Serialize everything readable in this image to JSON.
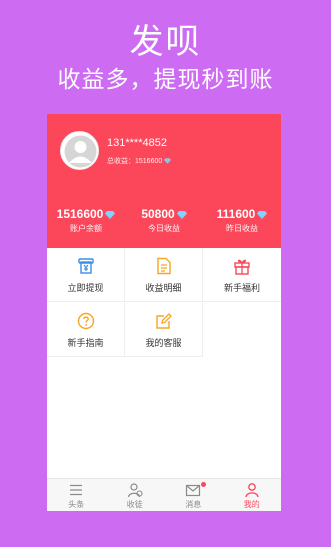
{
  "promo": {
    "title": "发呗",
    "subtitle": "收益多，提现秒到账"
  },
  "profile": {
    "phone": "131****4852",
    "total_label": "总收益：",
    "total_value": "1516600"
  },
  "stats": [
    {
      "value": "1516600",
      "label": "账户余额"
    },
    {
      "value": "50800",
      "label": "今日收益"
    },
    {
      "value": "111600",
      "label": "昨日收益"
    }
  ],
  "menu": [
    {
      "label": "立即提现",
      "icon": "withdraw-icon"
    },
    {
      "label": "收益明细",
      "icon": "detail-icon"
    },
    {
      "label": "新手福利",
      "icon": "gift-icon"
    },
    {
      "label": "新手指南",
      "icon": "guide-icon"
    },
    {
      "label": "我的客服",
      "icon": "service-icon"
    }
  ],
  "tabs": [
    {
      "label": "头条",
      "icon": "list-icon"
    },
    {
      "label": "收徒",
      "icon": "apprentice-icon"
    },
    {
      "label": "消息",
      "icon": "mail-icon"
    },
    {
      "label": "我的",
      "icon": "user-icon"
    }
  ],
  "colors": {
    "background": "#cd6cf3",
    "accent": "#fc4659",
    "icon_blue": "#3a8ee6",
    "icon_orange": "#f5a623",
    "gem": "#7fd3ff"
  }
}
